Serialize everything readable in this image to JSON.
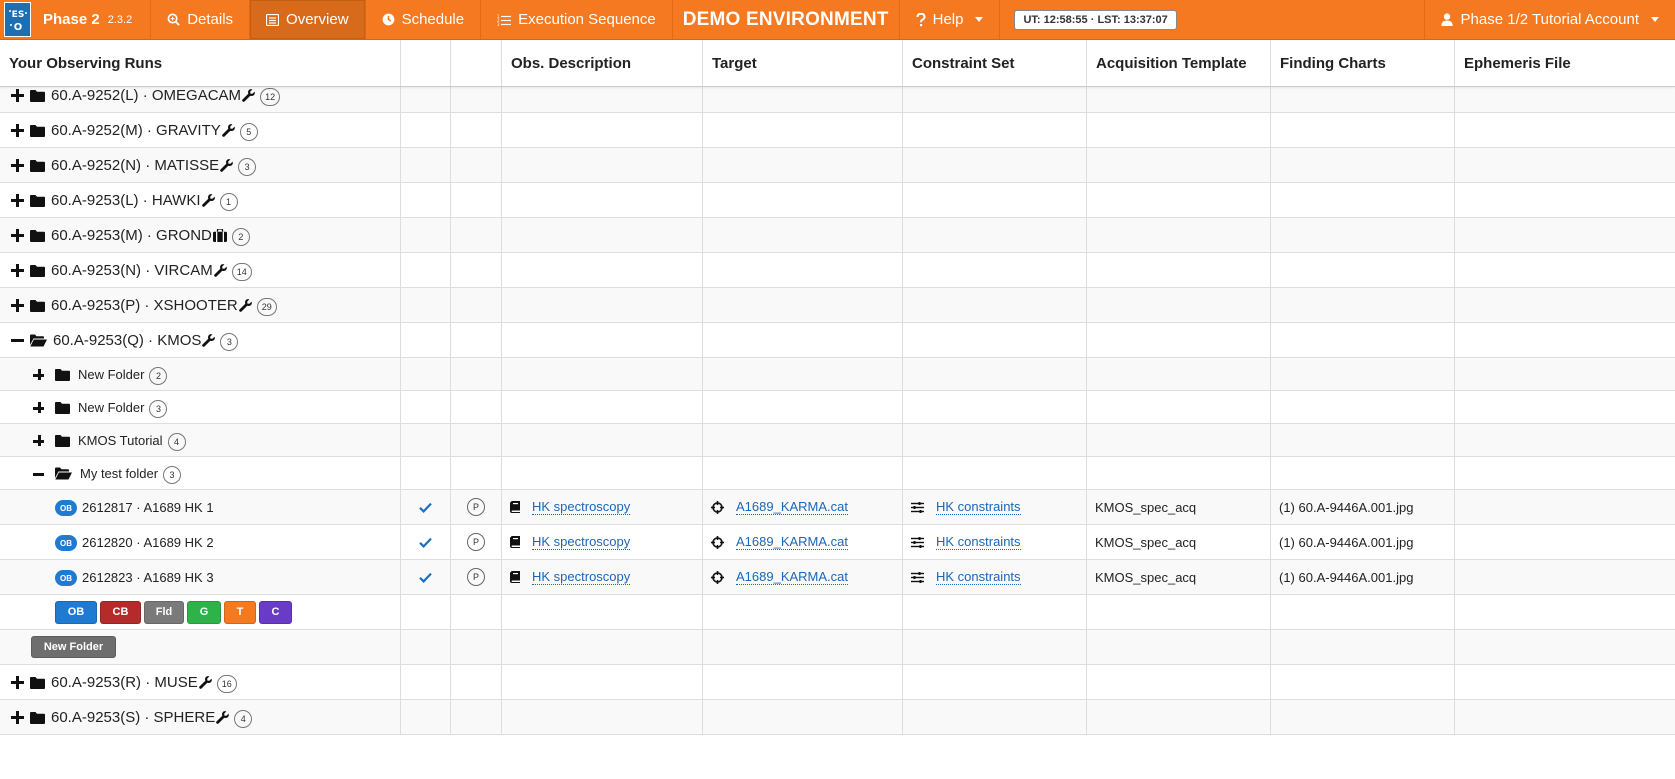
{
  "navbar": {
    "title": "Phase 2",
    "version": "2.3.2",
    "tabs": [
      {
        "label": "Details",
        "icon": "search-zoom-icon"
      },
      {
        "label": "Overview",
        "icon": "list-icon",
        "active": true
      },
      {
        "label": "Schedule",
        "icon": "clock-icon"
      },
      {
        "label": "Execution Sequence",
        "icon": "numbered-list-icon"
      }
    ],
    "environment": "DEMO ENVIRONMENT",
    "help_label": "Help",
    "clock": "UT: 12:58:55 · LST: 13:37:07",
    "account_label": "Phase 1/2 Tutorial Account"
  },
  "table": {
    "headers": [
      "Your Observing Runs",
      "",
      "",
      "Obs. Description",
      "Target",
      "Constraint Set",
      "Acquisition Template",
      "Finding Charts",
      "Ephemeris File"
    ]
  },
  "runs_top": [
    {
      "label": "60.A-9252(L) · OMEGACAM",
      "count": "12",
      "icon": "wrench-icon"
    },
    {
      "label": "60.A-9252(M) · GRAVITY",
      "count": "5",
      "icon": "wrench-icon"
    },
    {
      "label": "60.A-9252(N) · MATISSE",
      "count": "3",
      "icon": "wrench-icon"
    },
    {
      "label": "60.A-9253(L) · HAWKI",
      "count": "1",
      "icon": "wrench-icon"
    },
    {
      "label": "60.A-9253(M) · GROND",
      "count": "2",
      "icon": "briefcase-icon"
    },
    {
      "label": "60.A-9253(N) · VIRCAM",
      "count": "14",
      "icon": "wrench-icon"
    },
    {
      "label": "60.A-9253(P) · XSHOOTER",
      "count": "29",
      "icon": "wrench-icon"
    }
  ],
  "open_run": {
    "label": "60.A-9253(Q) · KMOS",
    "count": "3"
  },
  "subfolders": [
    {
      "label": "New Folder",
      "count": "2"
    },
    {
      "label": "New Folder",
      "count": "3"
    },
    {
      "label": "KMOS Tutorial",
      "count": "4"
    }
  ],
  "open_folder": {
    "label": "My test folder",
    "count": "3"
  },
  "obs": [
    {
      "badge": "OB",
      "label": "2612817 · A1689 HK 1",
      "status": "P",
      "description": "HK spectroscopy",
      "target": "A1689_KARMA.cat",
      "constraints": "HK constraints",
      "acquisition": "KMOS_spec_acq",
      "finding_chart": "(1) 60.A-9446A.001.jpg"
    },
    {
      "badge": "OB",
      "label": "2612820 · A1689 HK 2",
      "status": "P",
      "description": "HK spectroscopy",
      "target": "A1689_KARMA.cat",
      "constraints": "HK constraints",
      "acquisition": "KMOS_spec_acq",
      "finding_chart": "(1) 60.A-9446A.001.jpg"
    },
    {
      "badge": "OB",
      "label": "2612823 · A1689 HK 3",
      "status": "P",
      "description": "HK spectroscopy",
      "target": "A1689_KARMA.cat",
      "constraints": "HK constraints",
      "acquisition": "KMOS_spec_acq",
      "finding_chart": "(1) 60.A-9446A.001.jpg"
    }
  ],
  "create_buttons": {
    "ob": "OB",
    "cb": "CB",
    "fld": "Fld",
    "g": "G",
    "t": "T",
    "c": "C"
  },
  "new_folder_label": "New Folder",
  "runs_bottom": [
    {
      "label": "60.A-9253(R) · MUSE",
      "count": "16",
      "icon": "wrench-icon"
    },
    {
      "label": "60.A-9253(S) · SPHERE",
      "count": "4",
      "icon": "wrench-icon"
    }
  ],
  "colors": {
    "navbar": "#f47920",
    "ob_badge": "#1f7bd1",
    "cb_button": "#b52a2a",
    "g_button": "#2db34a",
    "c_button": "#6a3bc6",
    "link": "#1a66b8"
  }
}
